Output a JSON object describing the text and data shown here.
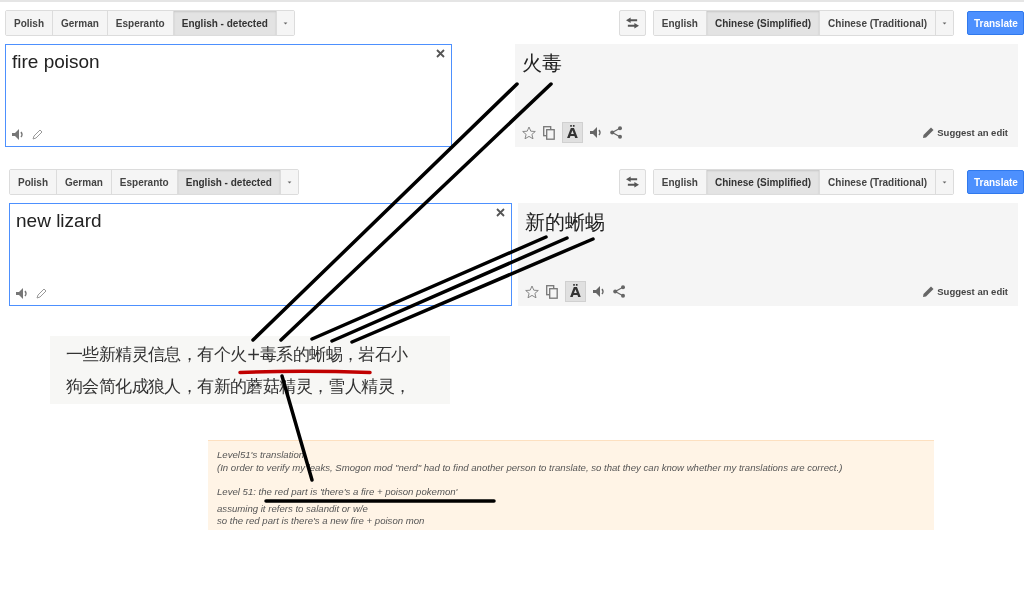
{
  "translators": [
    {
      "source_languages": [
        {
          "label": "Polish",
          "selected": false
        },
        {
          "label": "German",
          "selected": false
        },
        {
          "label": "Esperanto",
          "selected": false
        },
        {
          "label": "English - detected",
          "selected": true
        }
      ],
      "target_languages": [
        {
          "label": "English",
          "selected": false
        },
        {
          "label": "Chinese (Simplified)",
          "selected": true
        },
        {
          "label": "Chinese (Traditional)",
          "selected": false
        }
      ],
      "translate_button": "Translate",
      "input_text": "fire poison",
      "output_text": "火毒",
      "romanization_button": {
        "label": "Ä",
        "on": true
      },
      "suggest_edit": "Suggest an edit"
    },
    {
      "source_languages": [
        {
          "label": "Polish",
          "selected": false
        },
        {
          "label": "German",
          "selected": false
        },
        {
          "label": "Esperanto",
          "selected": false
        },
        {
          "label": "English - detected",
          "selected": true
        }
      ],
      "target_languages": [
        {
          "label": "English",
          "selected": false
        },
        {
          "label": "Chinese (Simplified)",
          "selected": true
        },
        {
          "label": "Chinese (Traditional)",
          "selected": false
        }
      ],
      "translate_button": "Translate",
      "input_text": "new lizard",
      "output_text": "新的蜥蜴",
      "romanization_button": {
        "label": "Ä",
        "on": true
      },
      "suggest_edit": "Suggest an edit"
    }
  ],
  "source_excerpt": {
    "lines": [
      "一些新精灵信息，有个火+毒系的蜥蜴，岩石小",
      "狗会简化成狼人，有新的蘑菇精灵，雪人精灵，"
    ]
  },
  "translation_note": {
    "intro_lines": [
      "Level51's translation",
      "(In order to verify my leaks, Smogon mod \"nerd\" had to find another person to translate, so that they can know whether my translations are correct.)"
    ],
    "reply_lines": [
      "Level 51: the red part is 'there's a fire + poison pokemon'",
      "assuming it refers to salandit or w/e",
      "so the red part is there's a new fire + poison mon"
    ]
  }
}
